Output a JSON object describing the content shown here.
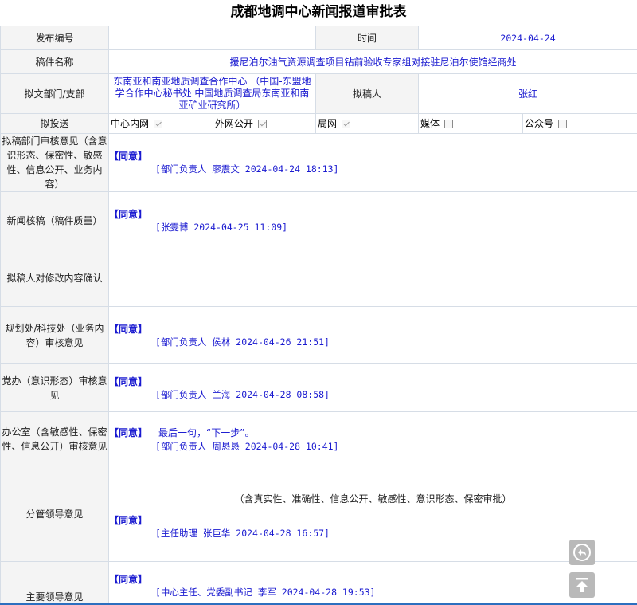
{
  "title": "成都地调中心新闻报道审批表",
  "row_publish": {
    "label": "发布编号",
    "value": "",
    "time_label": "时间",
    "time_value": "2024-04-24"
  },
  "row_manuscript": {
    "label": "稿件名称",
    "value": "援尼泊尔油气资源调查项目钻前验收专家组对接驻尼泊尔使馆经商处"
  },
  "row_dept": {
    "label": "拟文部门/支部",
    "value": "东南亚和南亚地质调查合作中心 （中国-东盟地学合作中心秘书处 中国地质调查局东南亚和南亚矿业研究所）",
    "drafter_label": "拟稿人",
    "drafter_value": "张红"
  },
  "row_send": {
    "label": "拟投送",
    "options": [
      {
        "label": "中心内网",
        "checked": true
      },
      {
        "label": "外网公开",
        "checked": true
      },
      {
        "label": "局网",
        "checked": true
      },
      {
        "label": "媒体",
        "checked": false
      },
      {
        "label": "公众号",
        "checked": false
      }
    ]
  },
  "opinions": [
    {
      "label": "拟稿部门审核意见（含意识形态、保密性、敏感性、信息公开、业务内容）",
      "agree": "【同意】",
      "comment": "",
      "signature": "[部门负责人 廖震文 2024-04-24 18:13]"
    },
    {
      "label": "新闻核稿（稿件质量）",
      "agree": "【同意】",
      "comment": "",
      "signature": "[张雯博 2024-04-25 11:09]"
    },
    {
      "label": "拟稿人对修改内容确认",
      "agree": "",
      "comment": "",
      "signature": ""
    },
    {
      "label": "规划处/科技处（业务内容）审核意见",
      "agree": "【同意】",
      "comment": "",
      "signature": "[部门负责人 侯林 2024-04-26 21:51]"
    },
    {
      "label": "党办（意识形态）审核意见",
      "agree": "【同意】",
      "comment": "",
      "signature": "[部门负责人 兰海 2024-04-28 08:58]"
    },
    {
      "label": "办公室（含敏感性、保密性、信息公开）审核意见",
      "agree": "【同意】",
      "comment": "最后一句，“下一步”。",
      "signature": "[部门负责人 周恳恳 2024-04-28 10:41]"
    }
  ],
  "leader": {
    "label": "分管领导意见",
    "note": "（含真实性、准确性、信息公开、敏感性、意识形态、保密审批）",
    "agree": "【同意】",
    "signature": "[主任助理 张巨华 2024-04-28 16:57]"
  },
  "main_leader": {
    "label": "主要领导意见",
    "agree": "【同意】",
    "signature": "[中心主任、党委副书记 李军 2024-04-28 19:53]"
  },
  "icons": {
    "back": "back-arrow-icon",
    "top": "scroll-to-top-icon"
  }
}
